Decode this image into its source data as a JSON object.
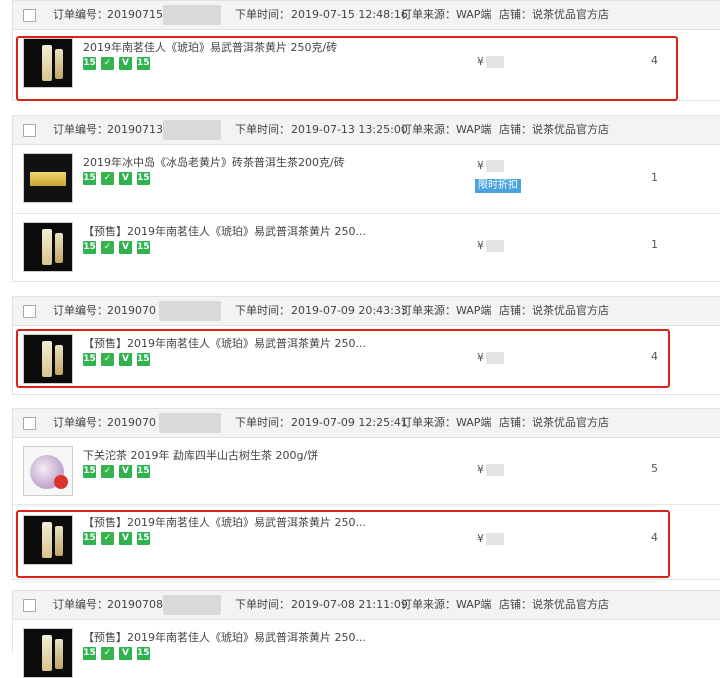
{
  "labels": {
    "order_no": "订单编号：",
    "order_time": "下单时间：",
    "source": "订单来源：WAP端",
    "store": "店铺：说茶优品官方店"
  },
  "orders": [
    {
      "order_no": "20190715",
      "time": "2019-07-15 12:48:16",
      "items": [
        {
          "title": "2019年南茗佳人《琥珀》易武普洱茶黄片 250克/砖",
          "price": "¥",
          "qty": "4"
        }
      ]
    },
    {
      "order_no": "20190713",
      "time": "2019-07-13 13:25:00",
      "items": [
        {
          "title": "2019年冰中岛《冰岛老黄片》砖茶普洱生茶200克/砖",
          "price": "¥",
          "badge": "限时折扣",
          "qty": "1"
        },
        {
          "title": "【预售】2019年南茗佳人《琥珀》易武普洱茶黄片 250...",
          "price": "¥",
          "qty": "1"
        }
      ]
    },
    {
      "order_no": "2019070",
      "time": "2019-07-09 20:43:33",
      "items": [
        {
          "title": "【预售】2019年南茗佳人《琥珀》易武普洱茶黄片 250...",
          "price": "¥",
          "qty": "4"
        }
      ]
    },
    {
      "order_no": "2019070",
      "time": "2019-07-09 12:25:41",
      "items": [
        {
          "title": "下关沱茶 2019年 勐库四半山古树生茶 200g/饼",
          "price": "¥",
          "qty": "5"
        },
        {
          "title": "【预售】2019年南茗佳人《琥珀》易武普洱茶黄片 250...",
          "price": "¥",
          "qty": "4"
        }
      ]
    },
    {
      "order_no": "20190708",
      "time": "2019-07-08 21:11:09",
      "items": [
        {
          "title": "【预售】2019年南茗佳人《琥珀》易武普洱茶黄片 250...",
          "price": "",
          "qty": ""
        }
      ]
    }
  ],
  "product_icons": [
    "15",
    "shield-icon",
    "v-icon",
    "15."
  ],
  "colors": {
    "highlight": "#d9231a",
    "icon_green": "#2fb34e",
    "badge_blue": "#4aa3df"
  }
}
